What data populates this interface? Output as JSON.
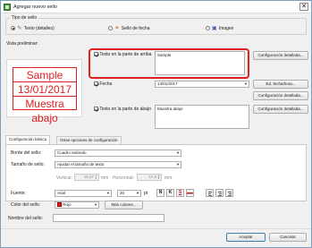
{
  "window": {
    "title": "Agregar nuevo sello",
    "close_glyph": "✕"
  },
  "stamp_type": {
    "legend": "Tipo de sello",
    "options": [
      {
        "label": "Texto (detalles)",
        "icon": "pen-icon",
        "selected": true
      },
      {
        "label": "Sello de fecha",
        "icon": "date-stamp-icon",
        "selected": false
      },
      {
        "label": "Imagen",
        "icon": "image-icon",
        "selected": false
      }
    ]
  },
  "preview": {
    "label": "Vista preliminar:",
    "lines": [
      "Sample",
      "13/01/2017",
      "Muestra abajo"
    ],
    "color": "#e02020"
  },
  "top_text": {
    "checkbox_label": "Texto en la parte de arriba",
    "checked": true,
    "value": "Sample",
    "detail_button": "Configuración detallada..."
  },
  "date": {
    "checkbox_label": "Fecha",
    "checked": true,
    "value": "13/01/2017",
    "format_button": "Ed. fecha/hora...",
    "detail_button": "Configuración detallada..."
  },
  "bottom_text": {
    "checkbox_label": "Texto en la parte de abajo",
    "checked": true,
    "value": "Muestra abajo",
    "detail_button": "Configuración detallada..."
  },
  "tabs": {
    "basic": "Configuración básica",
    "other": "Otras opciones de configuración"
  },
  "basic": {
    "border_label": "Borde del sello:",
    "border_value": "Cuadro redondo",
    "size_label": "Tamaño de sello:",
    "size_value": "Ajustar el tamaño de texto",
    "vertical_label": "Vertical:",
    "vertical_value": "16.27",
    "vertical_unit": "mm",
    "horizontal_label": "Horizontal:",
    "horizontal_value": "47.8",
    "horizontal_unit": "mm",
    "font_label": "Fuente:",
    "font_value": "Arial",
    "font_size": "20",
    "font_size_unit": "pt",
    "bold": "N",
    "italic": "K",
    "underline": "S",
    "strike": "abc",
    "color_label": "Color del sello:",
    "color_value": "Rojo",
    "more_colors": "Más colores..."
  },
  "name": {
    "label": "Nombre del sello:",
    "value": ""
  },
  "footer": {
    "accept": "Aceptar",
    "cancel": "Cancelar"
  },
  "colors": {
    "highlight": "#e02020",
    "window_bg": "#f0f0f0"
  }
}
